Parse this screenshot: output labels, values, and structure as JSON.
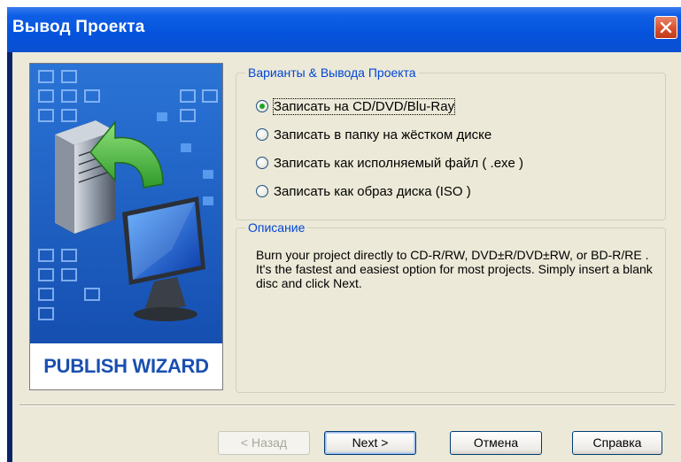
{
  "window": {
    "title": "Вывод Проекта"
  },
  "banner": {
    "label": "PUBLISH WIZARD"
  },
  "options": {
    "group_title": "Варианты & Вывода Проекта",
    "items": [
      {
        "label": "Записать на CD/DVD/Blu-Ray",
        "checked": true
      },
      {
        "label": "Записать в папку на жёстком диске",
        "checked": false
      },
      {
        "label": "Записать как исполняемый файл ( .exe )",
        "checked": false
      },
      {
        "label": "Записать как образ диска  (ISO )",
        "checked": false
      }
    ]
  },
  "description": {
    "group_title": "Описание",
    "text": "Burn your project directly to CD-R/RW, DVD±R/DVD±RW, or BD-R/RE . It's the fastest and easiest option for most projects. Simply insert a blank disc and click Next."
  },
  "buttons": {
    "back": "< Назад",
    "next": "Next >",
    "cancel": "Отмена",
    "help": "Справка"
  },
  "colors": {
    "titlebar": "#0553dc",
    "dialog_bg": "#ece9d8",
    "banner_bg": "#1f63c9",
    "group_title": "#0046d5"
  }
}
